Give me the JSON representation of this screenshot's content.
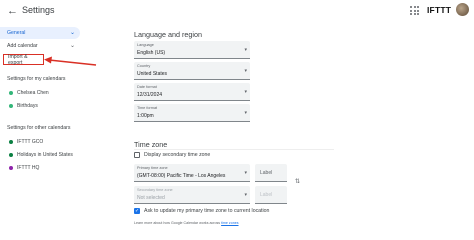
{
  "header": {
    "title": "Settings",
    "back_icon": "arrow-left-icon",
    "apps_icon": "grid-icon",
    "brand": "IFTTT"
  },
  "sidebar": {
    "general": "General",
    "add_calendar": "Add calendar",
    "import_export": "Import & export",
    "my_calendars_title": "Settings for my calendars",
    "my_calendars": [
      {
        "name": "Chelsea Chen",
        "color": "#33b679"
      },
      {
        "name": "Birthdays",
        "color": "#33b679"
      }
    ],
    "other_calendars_title": "Settings for other calendars",
    "other_calendars": [
      {
        "name": "IFTTT GCO",
        "color": "#0b8043"
      },
      {
        "name": "Holidays in United States",
        "color": "#0b8043"
      },
      {
        "name": "IFTTT HQ",
        "color": "#8e24aa"
      }
    ]
  },
  "annotation": {
    "color": "#d93025"
  },
  "main": {
    "language_section": "Language and region",
    "language": {
      "label": "Language",
      "value": "English (US)"
    },
    "country": {
      "label": "Country",
      "value": "United States"
    },
    "date_format": {
      "label": "Date format",
      "value": "12/31/2024"
    },
    "time_format": {
      "label": "Time format",
      "value": "1:00pm"
    },
    "timezone_section": "Time zone",
    "secondary_tz_checkbox": "Display secondary time zone",
    "primary_tz": {
      "label": "Primary time zone",
      "value": "(GMT-08:00) Pacific Time - Los Angeles"
    },
    "secondary_tz": {
      "label": "Secondary time zone",
      "value": "Not selected"
    },
    "label_placeholder": "Label",
    "label_placeholder_2": "Label",
    "ask_update": "Ask to update my primary time zone to current location",
    "learn_more_prefix": "Learn more about how Google Calendar works across ",
    "learn_more_link": "time zones"
  }
}
